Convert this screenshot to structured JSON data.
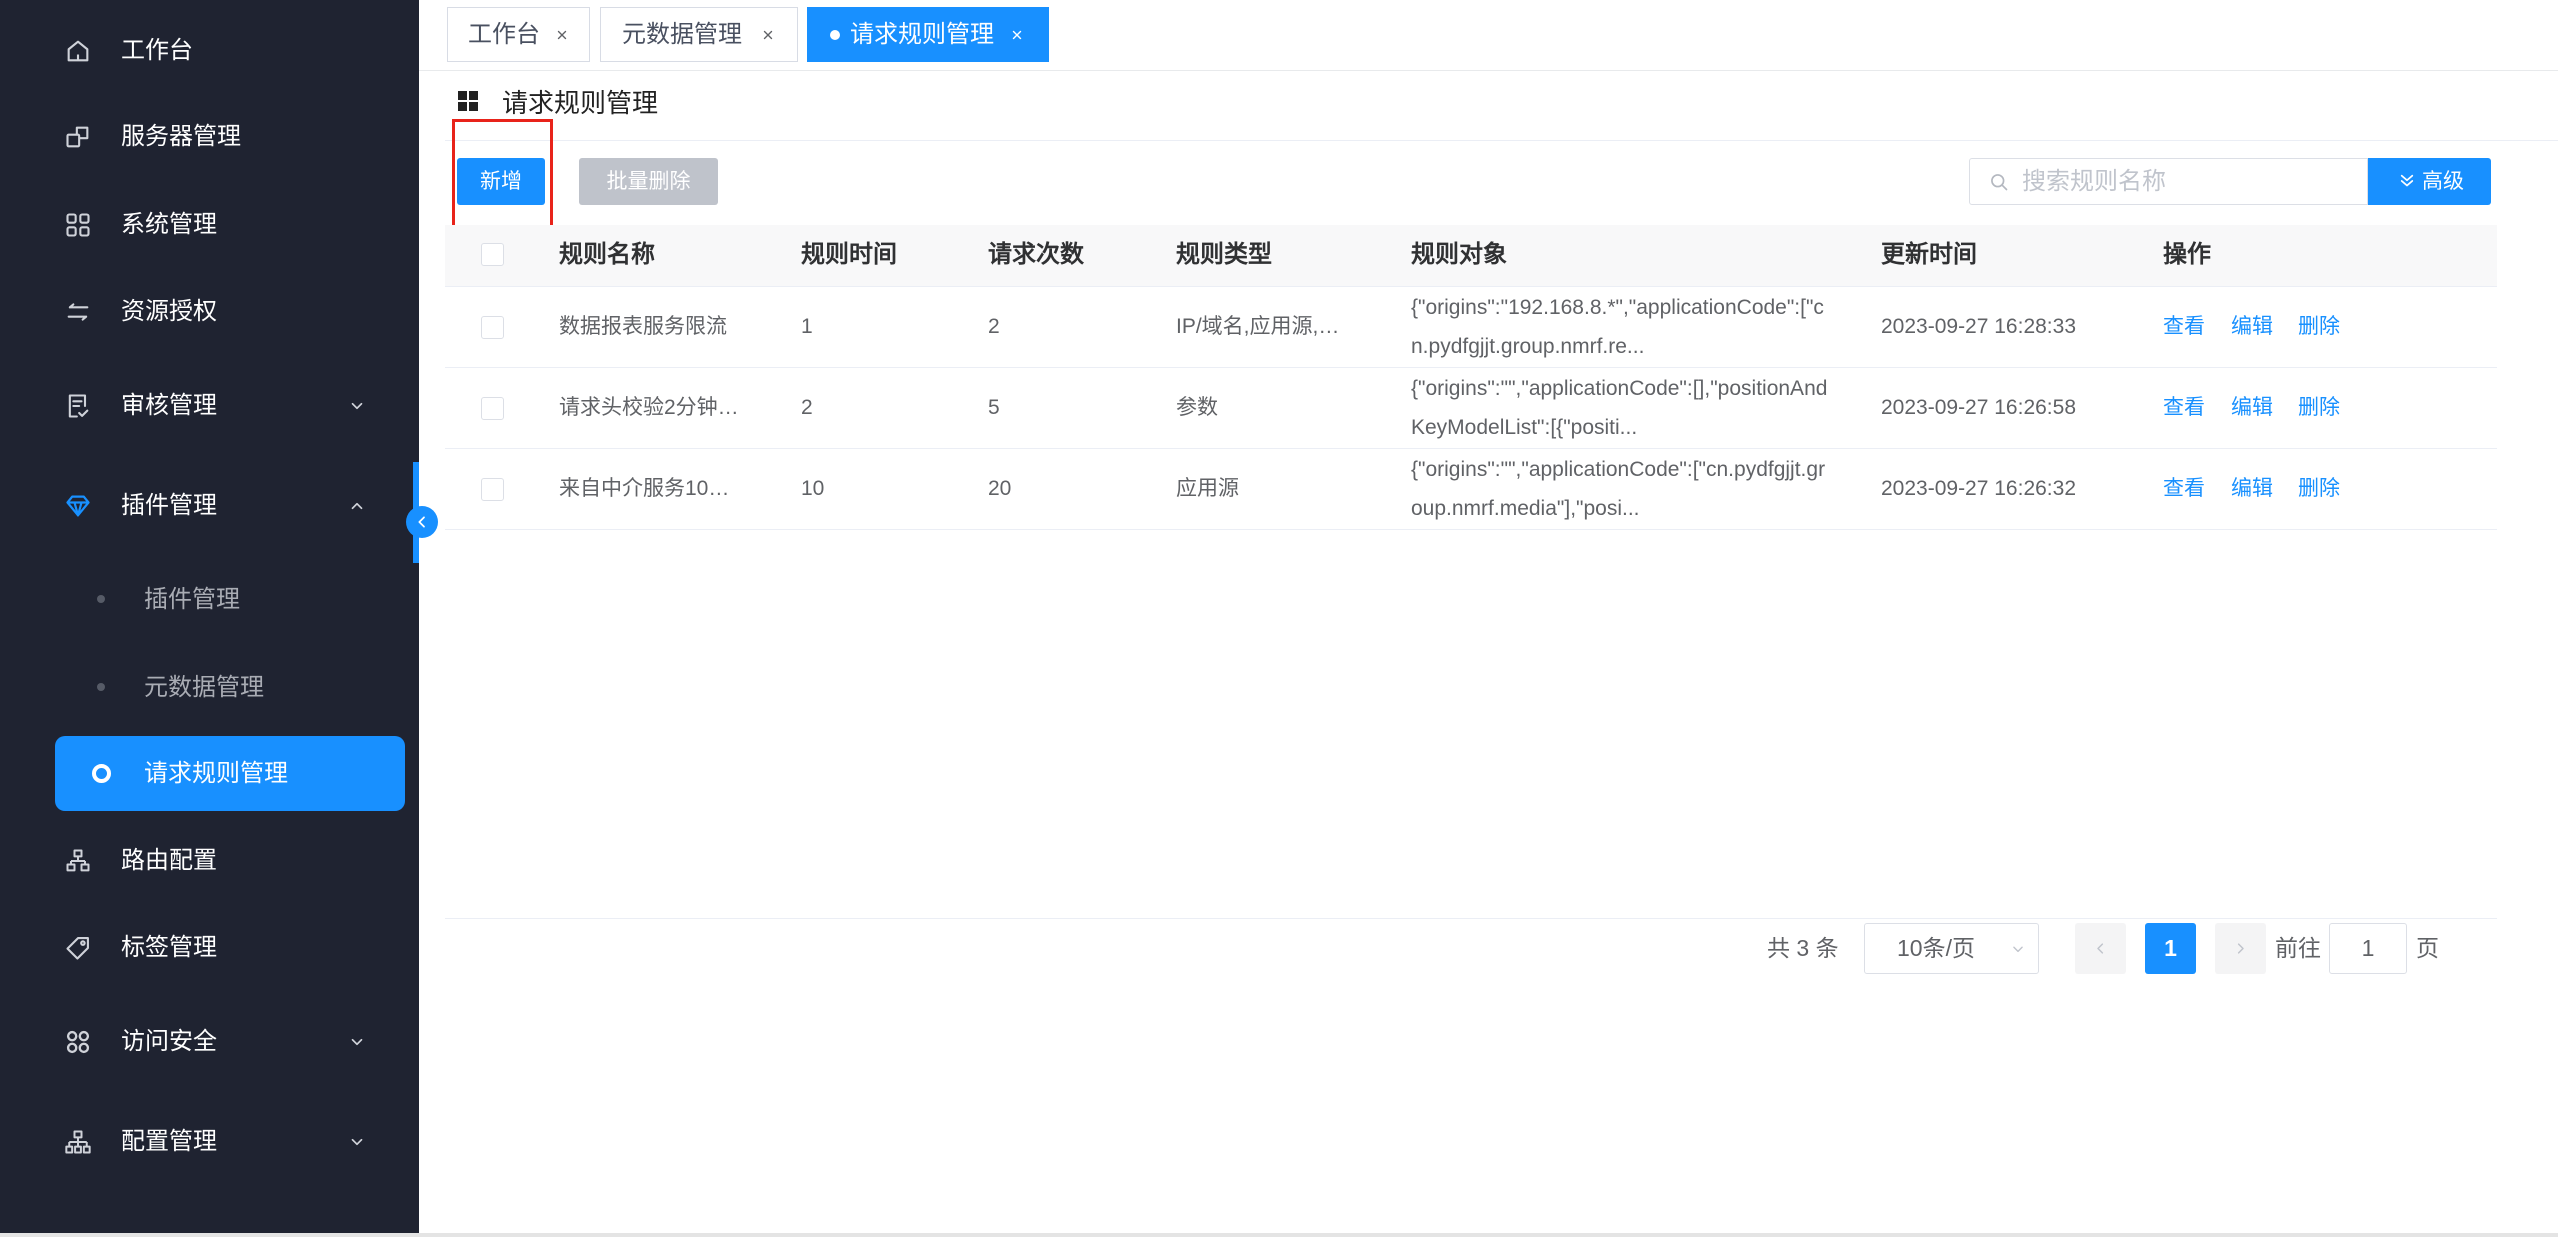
{
  "sidebar": {
    "menu": [
      {
        "label": "工作台",
        "icon": "home-icon"
      },
      {
        "label": "服务器管理",
        "icon": "server-icon"
      },
      {
        "label": "系统管理",
        "icon": "grid-icon"
      },
      {
        "label": "资源授权",
        "icon": "swap-icon"
      },
      {
        "label": "审核管理",
        "icon": "audit-icon",
        "arrow": "chevron-down-icon"
      },
      {
        "label": "插件管理",
        "icon": "diamond-icon",
        "arrow": "chevron-up-icon",
        "expanded": true
      },
      {
        "label": "路由配置",
        "icon": "route-icon"
      },
      {
        "label": "标签管理",
        "icon": "tag-icon"
      },
      {
        "label": "访问安全",
        "icon": "security-icon",
        "arrow": "chevron-down-icon"
      },
      {
        "label": "配置管理",
        "icon": "sitemap-icon",
        "arrow": "chevron-down-icon"
      }
    ],
    "submenu": [
      {
        "label": "插件管理",
        "active": false
      },
      {
        "label": "元数据管理",
        "active": false
      },
      {
        "label": "请求规则管理",
        "active": true
      }
    ],
    "collapse_icon": "chevron-left-icon"
  },
  "tabs": [
    {
      "label": "工作台",
      "active": false
    },
    {
      "label": "元数据管理",
      "active": false
    },
    {
      "label": "请求规则管理",
      "active": true
    }
  ],
  "page": {
    "title": "请求规则管理",
    "title_icon": "grid-icon"
  },
  "toolbar": {
    "add_label": "新增",
    "batch_delete_label": "批量删除",
    "search_placeholder": "搜索规则名称",
    "search_icon": "search-icon",
    "advanced_label": "高级",
    "advanced_icon": "double-chevron-down-icon"
  },
  "table": {
    "columns": [
      "规则名称",
      "规则时间",
      "请求次数",
      "规则类型",
      "规则对象",
      "更新时间",
      "操作"
    ],
    "rows": [
      {
        "name": "数据报表服务限流",
        "time": "1",
        "count": "2",
        "type": "IP/域名,应用源,…",
        "object": [
          "{\"origins\":\"192.168.8.*\",\"applicationCode\":[\"c",
          "n.pydfgjjt.group.nmrf.re..."
        ],
        "updated": "2023-09-27 16:28:33",
        "actions": [
          "查看",
          "编辑",
          "删除"
        ]
      },
      {
        "name": "请求头校验2分钟…",
        "time": "2",
        "count": "5",
        "type": "参数",
        "object": [
          "{\"origins\":\"\",\"applicationCode\":[],\"positionAnd",
          "KeyModelList\":[{\"positi..."
        ],
        "updated": "2023-09-27 16:26:58",
        "actions": [
          "查看",
          "编辑",
          "删除"
        ]
      },
      {
        "name": "来自中介服务10…",
        "time": "10",
        "count": "20",
        "type": "应用源",
        "object": [
          "{\"origins\":\"\",\"applicationCode\":[\"cn.pydfgjjt.gr",
          "oup.nmrf.media\"],\"posi..."
        ],
        "updated": "2023-09-27 16:26:32",
        "actions": [
          "查看",
          "编辑",
          "删除"
        ]
      }
    ]
  },
  "pagination": {
    "total_text": "共 3 条",
    "page_size": "10条/页",
    "current_page": "1",
    "goto_label": "前往",
    "goto_value": "1",
    "page_suffix": "页"
  },
  "colors": {
    "primary": "#1890ff",
    "sidebar_bg": "#1f2331",
    "disabled_button": "#bfc3cb",
    "highlight_box": "#e8231a"
  }
}
